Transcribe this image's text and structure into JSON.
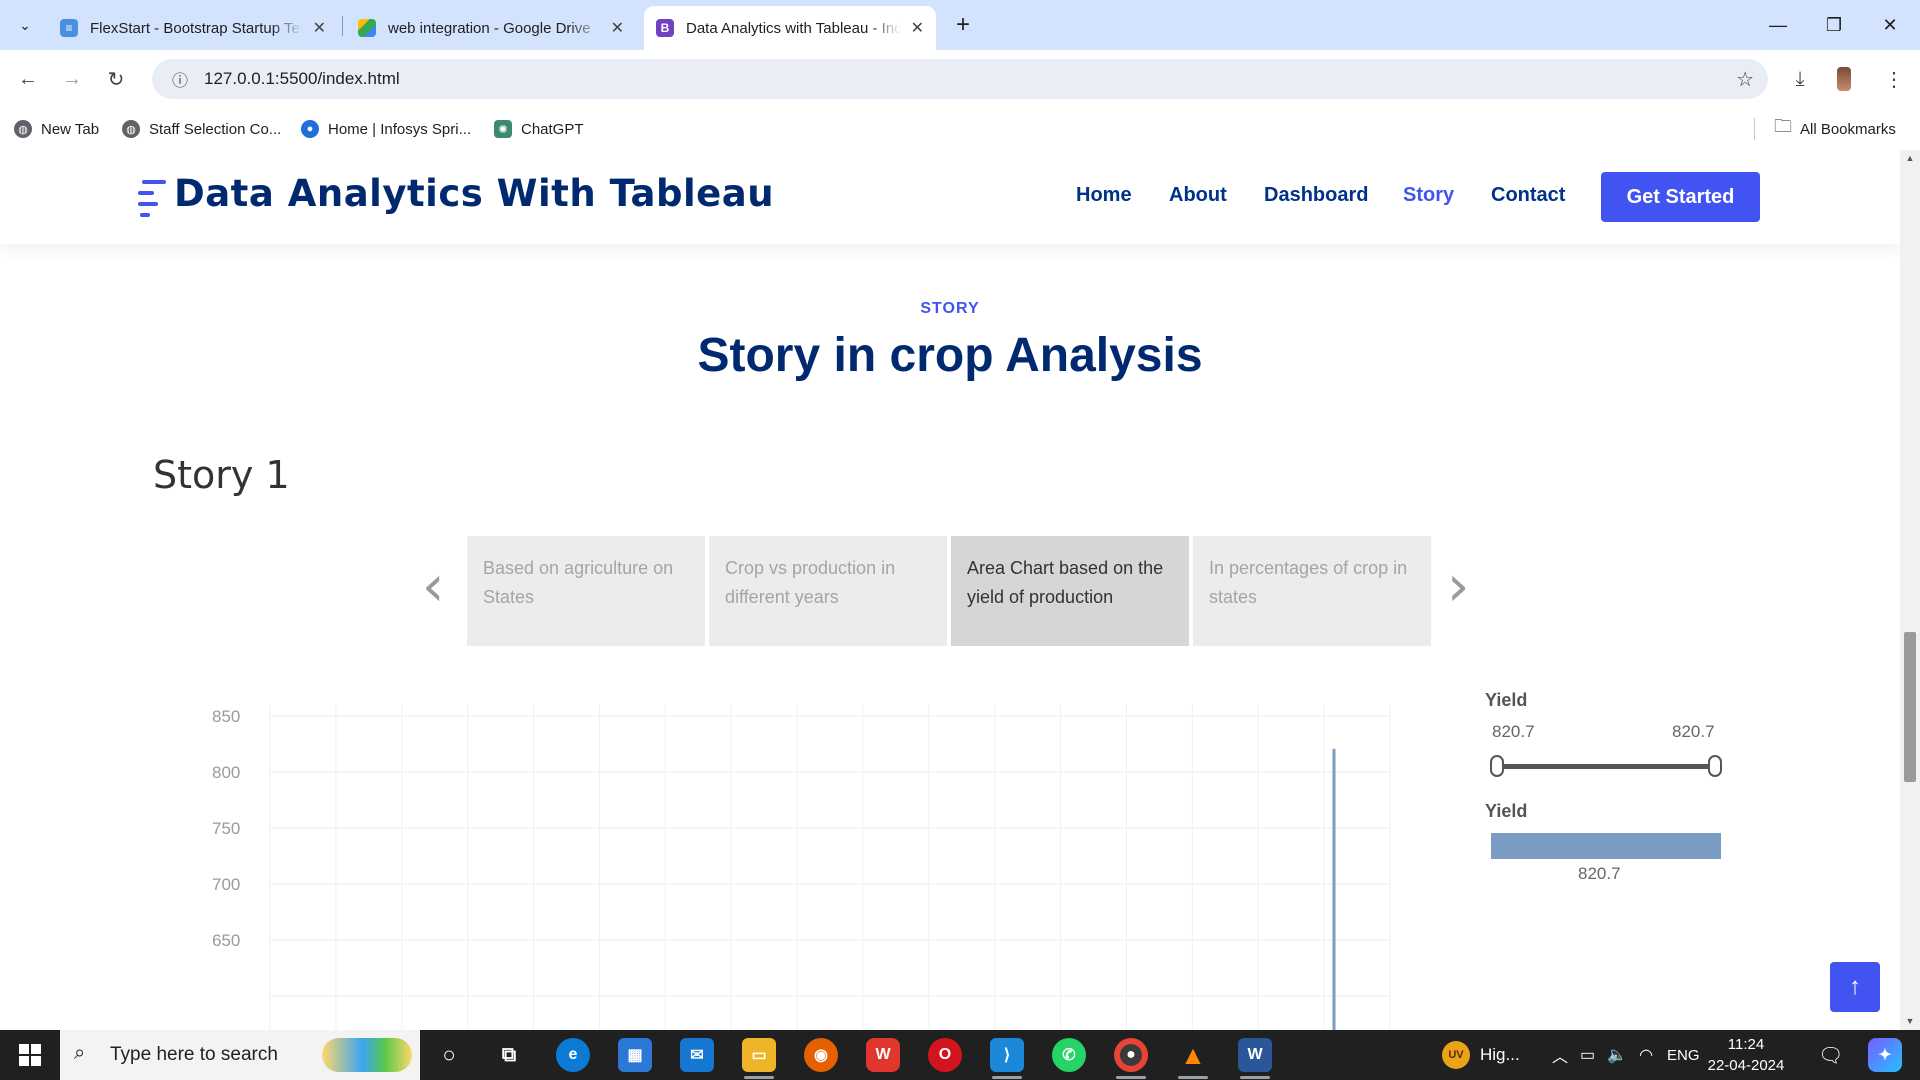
{
  "browser": {
    "tabs": [
      {
        "title": "FlexStart - Bootstrap Startup Template",
        "favicon": "flexstart-logo-icon",
        "color": "#4a90e2"
      },
      {
        "title": "web integration - Google Drive",
        "favicon": "google-drive-icon",
        "color": "#34a853"
      },
      {
        "title": "Data Analytics with Tableau - Index",
        "favicon": "bootstrap-icon",
        "color": "#6f42c1",
        "favicon_letter": "B"
      }
    ],
    "url": "127.0.0.1:5500/index.html",
    "bookmarks": [
      "New Tab",
      "Staff Selection Co...",
      "Home | Infosys Spri...",
      "ChatGPT"
    ],
    "all_bookmarks": "All Bookmarks"
  },
  "site": {
    "logo_text": "Data Analytics With Tableau",
    "nav": [
      "Home",
      "About",
      "Dashboard",
      "Story",
      "Contact"
    ],
    "active_nav": "Story",
    "cta": "Get Started",
    "accent": "#4154f1",
    "heading_color": "#012970"
  },
  "section": {
    "kicker": "STORY",
    "title": "Story in crop Analysis"
  },
  "story": {
    "title": "Story 1",
    "points": [
      "Based on agriculture on States",
      "Crop  vs production in different years",
      "Area Chart based on the yield of production",
      "In percentages of crop in states"
    ],
    "selected_index": 2
  },
  "chart_data": {
    "type": "area",
    "y_ticks": [
      "850",
      "800",
      "750",
      "700",
      "650"
    ],
    "ylim": [
      620,
      850
    ],
    "x_gridlines": 17,
    "series": [
      {
        "values": [
          820.7
        ],
        "color": "#7b9cc2"
      }
    ],
    "marker_x_fraction": 0.95,
    "grid": true
  },
  "legend": {
    "range_title": "Yield",
    "range_min": "820.7",
    "range_max": "820.7",
    "size_title": "Yield",
    "size_value": "820.7"
  },
  "back_to_top": "↑",
  "taskbar": {
    "search_placeholder": "Type here to search",
    "weather_text": "Hig...",
    "language": "ENG",
    "time": "11:24",
    "date": "22-04-2024",
    "user_initials": "UV"
  }
}
